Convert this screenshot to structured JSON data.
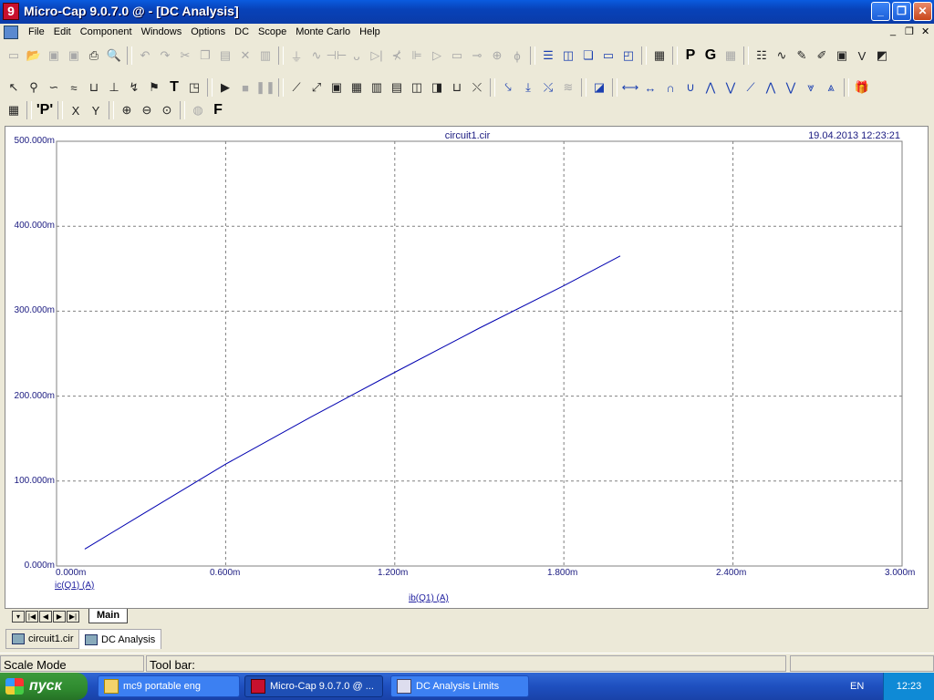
{
  "window": {
    "title": "Micro-Cap 9.0.7.0 @ - [DC Analysis]",
    "app_icon": "9",
    "btn_minimize": "_",
    "btn_restore": "❐",
    "btn_close": "✕"
  },
  "menubar": {
    "items": [
      "File",
      "Edit",
      "Component",
      "Windows",
      "Options",
      "DC",
      "Scope",
      "Monte Carlo",
      "Help"
    ]
  },
  "mdi_controls": {
    "minimize": "_",
    "restore": "❐",
    "close": "✕"
  },
  "plot": {
    "file": "circuit1.cir",
    "datetime": "19.04.2013 12:23:21",
    "y_ticks": [
      "500.000m",
      "400.000m",
      "300.000m",
      "200.000m",
      "100.000m",
      "0.000m"
    ],
    "x_ticks": [
      "0.000m",
      "0.600m",
      "1.200m",
      "1.800m",
      "2.400m",
      "3.000m"
    ],
    "y_title": "ic(Q1) (A)",
    "x_title": "ib(Q1) (A)",
    "trace_color": "#0000b0"
  },
  "chart_data": {
    "type": "line",
    "xlabel": "ib(Q1) (A)",
    "ylabel": "ic(Q1) (A)",
    "xlim": [
      0,
      3.0
    ],
    "ylim": [
      0,
      500
    ],
    "x_unit": "m",
    "y_unit": "m",
    "grid": true,
    "series": [
      {
        "x": [
          0.1,
          0.3,
          0.6,
          0.9,
          1.2,
          1.5,
          1.8,
          2.0
        ],
        "y": [
          20,
          60,
          120,
          175,
          228,
          280,
          330,
          365
        ]
      }
    ]
  },
  "tabs": {
    "main": "Main",
    "nav": [
      "▾",
      "|◀",
      "◀",
      "▶",
      "▶|"
    ]
  },
  "doc_tabs": [
    {
      "label": "circuit1.cir",
      "active": false
    },
    {
      "label": "DC Analysis",
      "active": true
    }
  ],
  "status": {
    "mode": "Scale Mode",
    "toolbar_hint": "Tool bar:"
  },
  "taskbar": {
    "start_label": "пуск",
    "items": [
      {
        "label": "mc9 portable eng",
        "active": false
      },
      {
        "label": "Micro-Cap 9.0.7.0 @ ...",
        "active": true
      },
      {
        "label": "DC Analysis Limits",
        "active": false
      }
    ],
    "lang": "EN",
    "clock": "12:23"
  },
  "toolbar_icons": {
    "row1": [
      "new-icon",
      "open-icon",
      "save-icon",
      "save-all-icon",
      "print-icon",
      "print-preview-icon",
      "undo-icon",
      "redo-icon",
      "cut-icon",
      "copy-icon",
      "paste-icon",
      "delete-icon",
      "select-all-icon",
      "ground-icon",
      "resistor-icon",
      "capacitor-icon",
      "inductor-icon",
      "diode-icon",
      "transistor-icon",
      "battery-icon",
      "opamp-icon",
      "window-icon",
      "windows-tile-icon",
      "cascade-icon",
      "window-frame-icon",
      "window-split-icon",
      "calculator-icon",
      "p-icon",
      "g-icon",
      "table-icon",
      "component-panel-icon",
      "waveform-icon",
      "pencil-icon",
      "marker-icon",
      "scope-icon",
      "vd-icon",
      "plot-icon"
    ],
    "row2": [
      "select-arrow-icon",
      "component-mode-icon",
      "wire-icon",
      "bus-icon",
      "node-icon",
      "junction-icon",
      "text-icon",
      "info-icon",
      "run-icon",
      "stop-icon",
      "pause-icon",
      "line-tool-icon",
      "line-tool-2-icon",
      "grid-icon",
      "grid-fine-icon",
      "column-icon",
      "rows-icon",
      "split-rows-icon",
      "split-cols-icon",
      "baseline-icon",
      "cursor-icon",
      "peak-icon",
      "valley-icon",
      "slope-icon",
      "scale-icon",
      "hcursor-icon",
      "vcursor-icon",
      "up-icon",
      "down-icon",
      "up-slope-icon",
      "down-slope-icon",
      "fine-icon",
      "multi-icon",
      "multi-2-icon",
      "multi-3-icon",
      "multi-4-icon",
      "package-icon"
    ],
    "row3": [
      "table-view-icon",
      "p-mode-icon",
      "x-axis-icon",
      "y-axis-icon",
      "zoom-in-icon",
      "zoom-out-icon",
      "zoom-fit-icon",
      "globe-icon",
      "f-icon"
    ]
  }
}
